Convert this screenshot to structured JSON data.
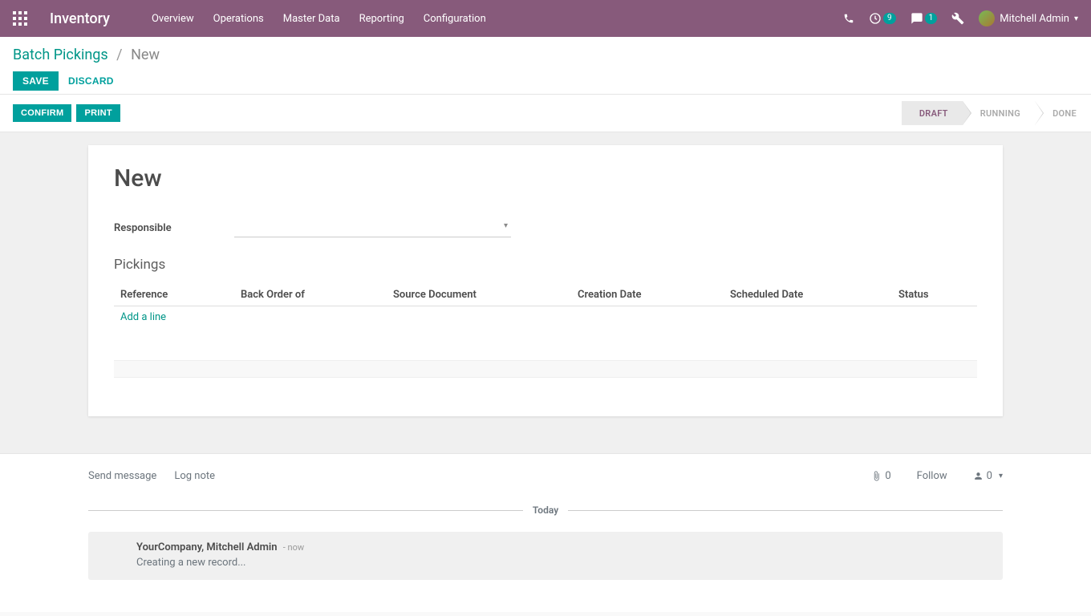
{
  "navbar": {
    "brand": "Inventory",
    "links": [
      "Overview",
      "Operations",
      "Master Data",
      "Reporting",
      "Configuration"
    ],
    "activity_count": "9",
    "message_count": "1",
    "user_name": "Mitchell Admin"
  },
  "breadcrumb": {
    "parent": "Batch Pickings",
    "current": "New"
  },
  "buttons": {
    "save": "Save",
    "discard": "Discard",
    "confirm": "Confirm",
    "print": "Print"
  },
  "status_steps": {
    "draft": "Draft",
    "running": "Running",
    "done": "Done"
  },
  "form": {
    "title": "New",
    "responsible_label": "Responsible",
    "responsible_value": "",
    "pickings_title": "Pickings",
    "columns": {
      "reference": "Reference",
      "back_order": "Back Order of",
      "source_doc": "Source Document",
      "creation_date": "Creation Date",
      "scheduled_date": "Scheduled Date",
      "status": "Status"
    },
    "add_line": "Add a line"
  },
  "chatter": {
    "send_message": "Send message",
    "log_note": "Log note",
    "attach_count": "0",
    "follow": "Follow",
    "follower_count": "0",
    "divider": "Today",
    "entry": {
      "author": "YourCompany, Mitchell Admin",
      "time": "- now",
      "body": "Creating a new record..."
    }
  }
}
